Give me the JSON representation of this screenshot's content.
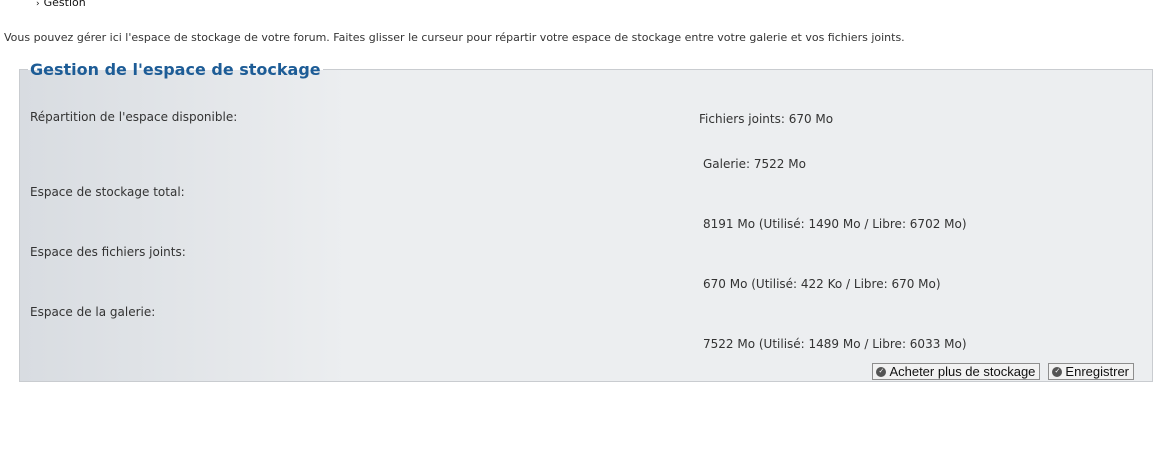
{
  "breadcrumb": {
    "current": "Gestion"
  },
  "intro_text": "Vous pouvez gérer ici l'espace de stockage de votre forum. Faites glisser le curseur pour répartir votre espace de stockage entre votre galerie et vos fichiers joints.",
  "panel": {
    "title": "Gestion de l'espace de stockage",
    "rows": {
      "repartition_label": "Répartition de l'espace disponible:",
      "attachments_alloc": "Fichiers joints: 670 Mo",
      "gallery_alloc": "Galerie: 7522 Mo",
      "total_label": "Espace de stockage total:",
      "total_value": "8191 Mo (Utilisé: 1490 Mo / Libre: 6702 Mo)",
      "attachments_label": "Espace des fichiers joints:",
      "attachments_value": "670 Mo (Utilisé: 422 Ko / Libre: 670 Mo)",
      "gallery_label": "Espace de la galerie:",
      "gallery_value": "7522 Mo (Utilisé: 1489 Mo / Libre: 6033 Mo)"
    },
    "buttons": {
      "buy_label": "Acheter plus de stockage",
      "save_label": "Enregistrer",
      "icon": "check-circle-icon"
    }
  },
  "colors": {
    "title": "#1d5c96",
    "panel_bg": "#eceef0",
    "panel_border": "#c9ccd0"
  }
}
